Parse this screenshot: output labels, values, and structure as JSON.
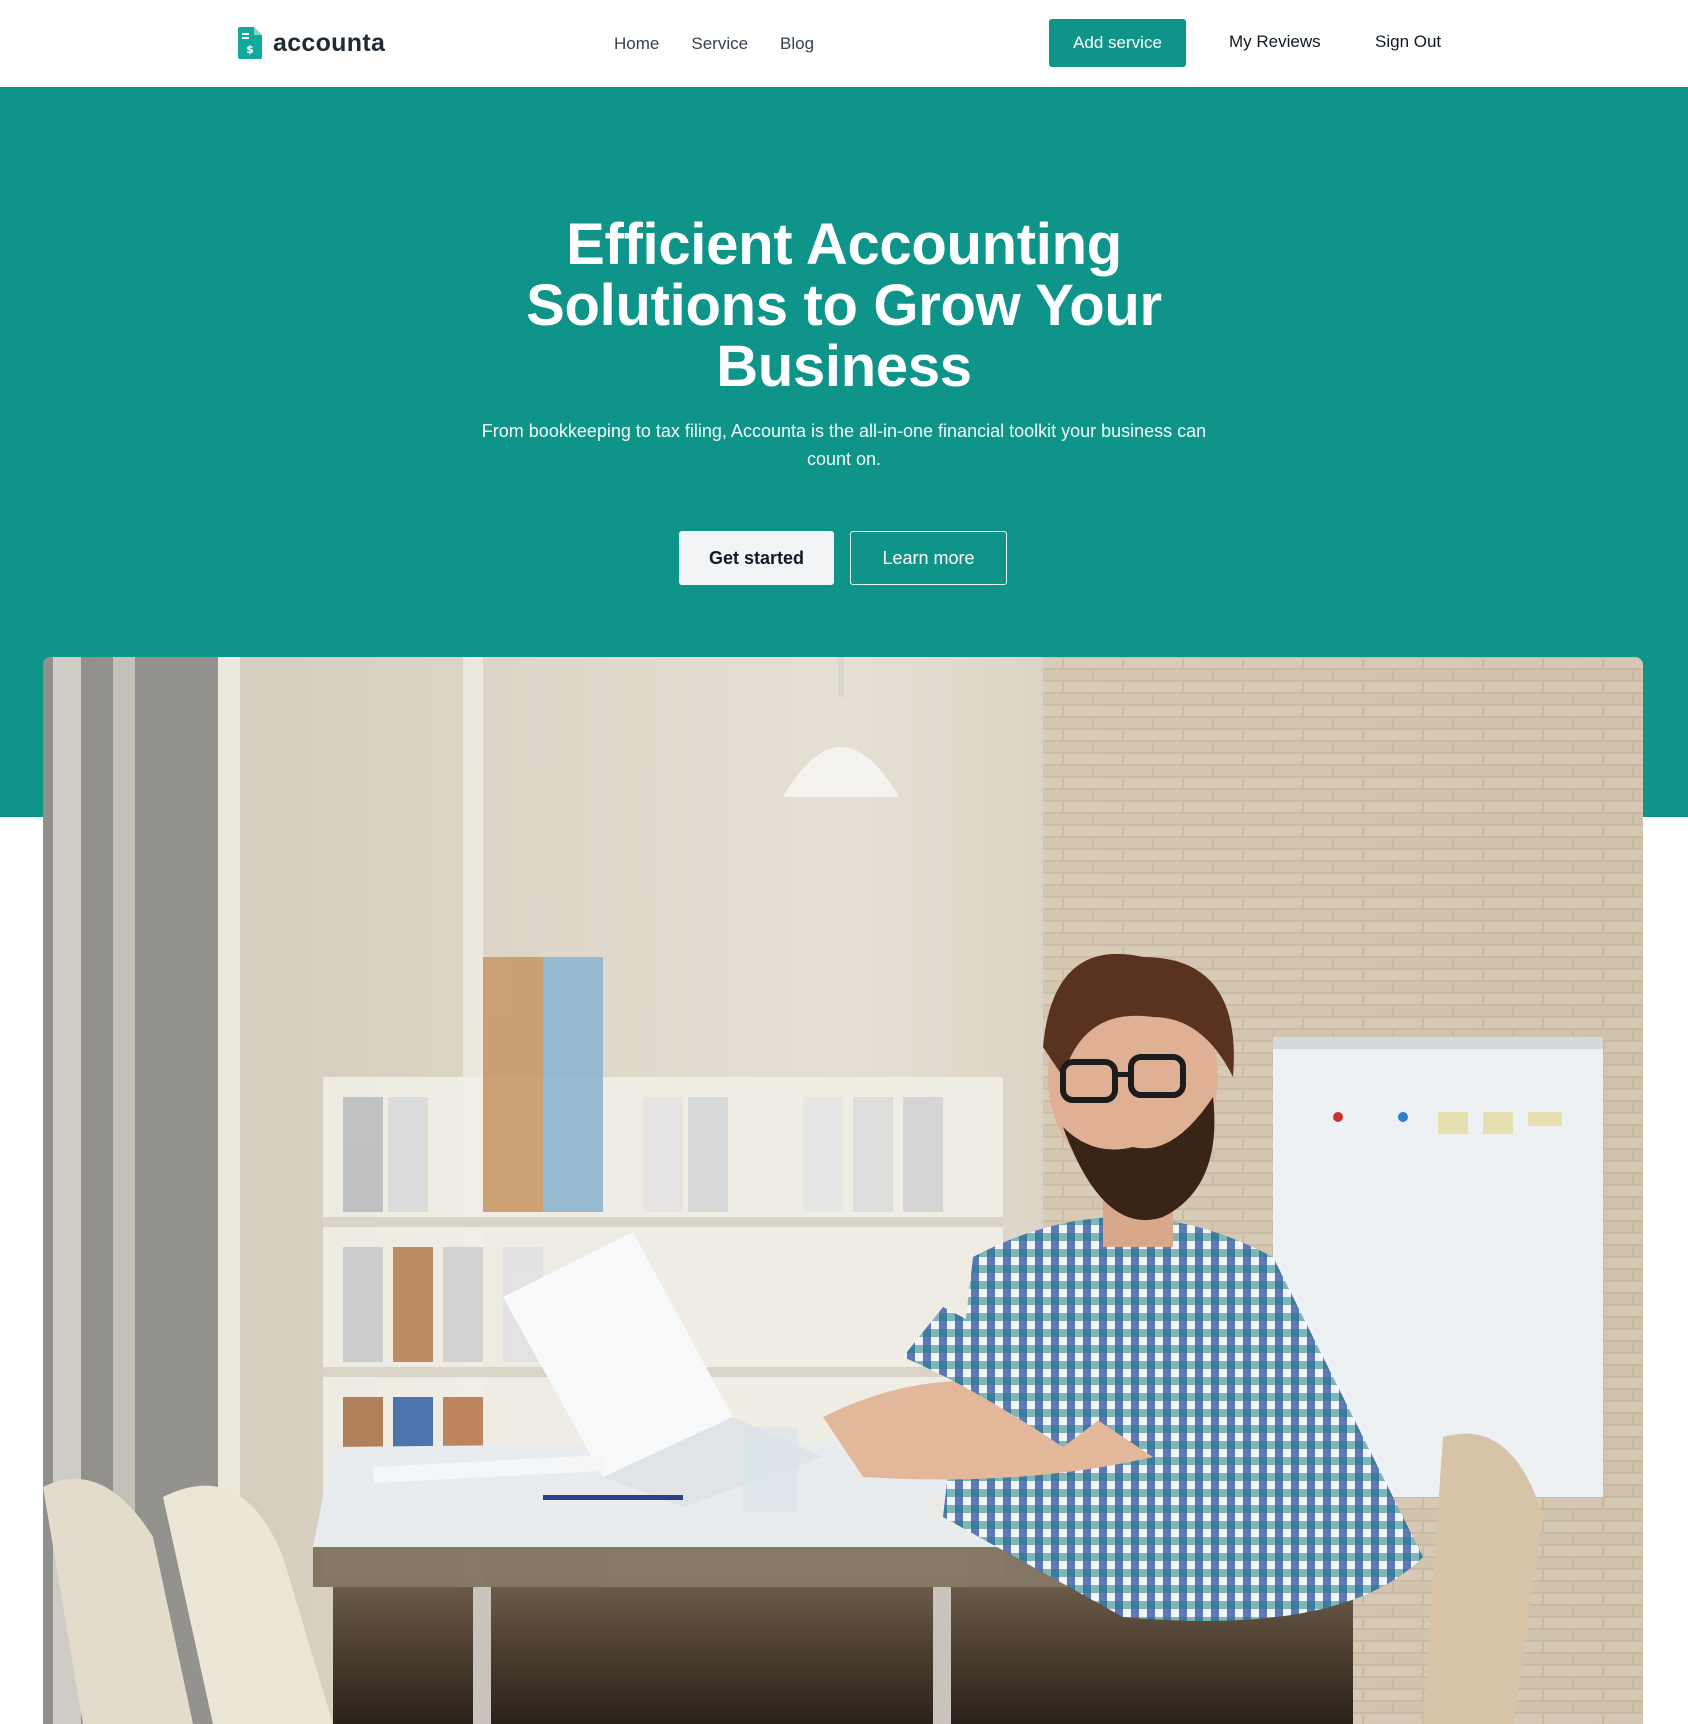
{
  "brand": {
    "name": "accounta",
    "icon": "document-dollar-icon",
    "color": "#13a89e"
  },
  "nav": {
    "links": [
      {
        "label": "Home"
      },
      {
        "label": "Service"
      },
      {
        "label": "Blog"
      }
    ],
    "add_service_label": "Add service",
    "my_reviews_label": "My Reviews",
    "sign_out_label": "Sign Out"
  },
  "hero": {
    "title": "Efficient Accounting Solutions to Grow Your Business",
    "subtitle": "From bookkeeping to tax filing, Accounta is the all-in-one financial toolkit your business can count on.",
    "primary_button": "Get started",
    "secondary_button": "Learn more",
    "background_color": "#0e9488"
  },
  "image": {
    "subject": "hero-office-photo"
  },
  "colors": {
    "accent": "#0e9488",
    "text_dark": "#1f2a33",
    "button_light": "#f3f4f6"
  }
}
